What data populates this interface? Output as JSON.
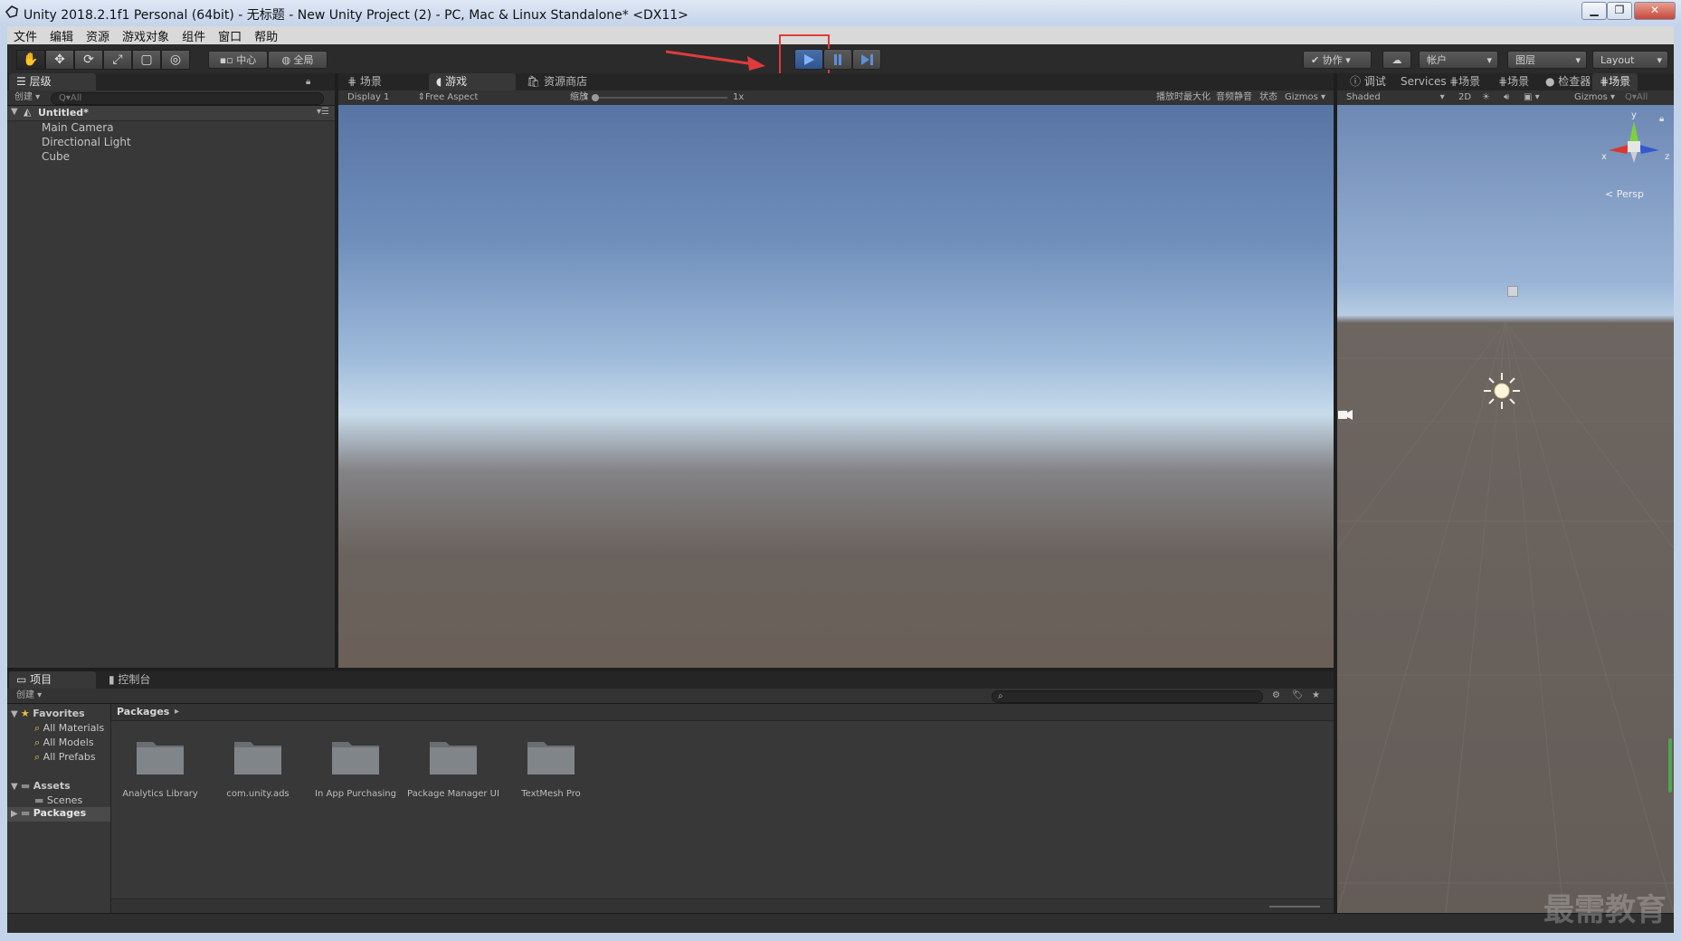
{
  "window": {
    "title": "Unity 2018.2.1f1 Personal (64bit) - 无标题 - New Unity Project (2) - PC, Mac & Linux Standalone* <DX11>",
    "controls": [
      "▁",
      "❐",
      "✕"
    ]
  },
  "menu": [
    "文件",
    "编辑",
    "资源",
    "游戏对象",
    "组件",
    "窗口",
    "帮助"
  ],
  "toolbar": {
    "pivot_label": "中心",
    "space_label": "全局",
    "collab_label": "协作",
    "account_label": "帐户",
    "layers_label": "图层",
    "layout_label": "Layout"
  },
  "hierarchy": {
    "tab_label": "层级",
    "create_label": "创建",
    "search_placeholder": "Q▾All",
    "scene_name": "Untitled*",
    "items": [
      "Main Camera",
      "Directional Light",
      "Cube"
    ]
  },
  "center_tabs": {
    "scene_tab": "场景",
    "game_tab": "游戏",
    "asset_store_tab": "资源商店"
  },
  "game_toolbar": {
    "display": "Display 1",
    "aspect": "Free Aspect",
    "scale_label": "缩放",
    "scale_value": "1x",
    "maximize": "播放时最大化",
    "mute": "音频静音",
    "stats": "状态",
    "gizmos": "Gizmos"
  },
  "right_tabs": {
    "debug": "调试",
    "services": "Services",
    "scene1": "场景",
    "scene2": "场景",
    "inspector": "检查器",
    "scene3": "场景"
  },
  "scene_toolbar": {
    "shading": "Shaded",
    "mode_2d": "2D",
    "gizmos": "Gizmos",
    "search": "Q▾All"
  },
  "scene_gizmo": {
    "persp_label": "Persp",
    "axis_y": "y",
    "axis_x": "x",
    "axis_z": "z"
  },
  "project": {
    "tab_label": "项目",
    "console_tab": "控制台",
    "create_label": "创建",
    "tree": {
      "favorites": "Favorites",
      "favorite_items": [
        "All Materials",
        "All Models",
        "All Prefabs"
      ],
      "assets": "Assets",
      "assets_children": [
        "Scenes"
      ],
      "packages": "Packages"
    },
    "breadcrumb": "Packages",
    "folders": [
      "Analytics Library",
      "com.unity.ads",
      "In App Purchasing",
      "Package Manager UI",
      "TextMesh Pro"
    ]
  },
  "watermark": "最需教育",
  "colors": {
    "highlight": "#e03b3b",
    "play_active": "#3c7ad1",
    "folder": "#6a6e72"
  }
}
